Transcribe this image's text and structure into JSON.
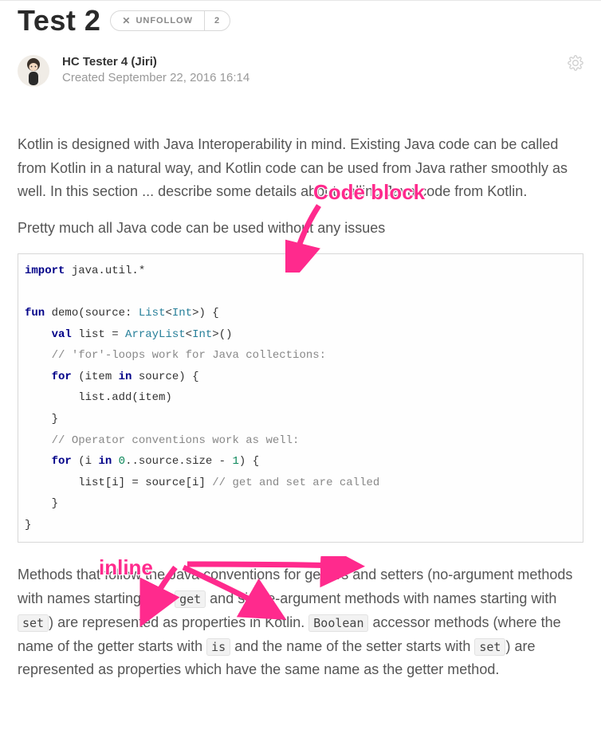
{
  "header": {
    "title": "Test 2",
    "follow": {
      "label": "UNFOLLOW",
      "count": "2"
    }
  },
  "meta": {
    "author": "HC Tester 4 (Jiri)",
    "created": "Created September 22, 2016 16:14"
  },
  "paragraphs": {
    "p1": "Kotlin is designed with Java Interoperability in mind. Existing Java code can be called from Kotlin in a natural way, and Kotlin code can be used from Java rather smoothly as well. In this section ... describe some details about calling Java code from Kotlin.",
    "p2": "Pretty much all Java code can be used without any issues",
    "p3a": "Methods that follow the Java conventions for getters and setters (no-argument methods with names starting with ",
    "p3b": " and single-argument methods with names starting with ",
    "p3c": ") are represented as properties in Kotlin. ",
    "p3d": " accessor methods (where the name of the getter starts with ",
    "p3e": " and the name of the setter starts with ",
    "p3f": ") are represented as properties which have the same name as the getter method."
  },
  "inline_codes": {
    "get": "get",
    "set1": "set",
    "bool": "Boolean",
    "is": "is",
    "set2": "set"
  },
  "code": {
    "l1_kw": "import",
    "l1_rest": " java.util.*",
    "l3_kw": "fun",
    "l3_fn": " demo",
    "l3_open": "(source: ",
    "l3_type1": "List",
    "l3_lt": "<",
    "l3_type2": "Int",
    "l3_gt": ">",
    "l3_close": ") {",
    "l4_kw": "val",
    "l4_mid": " list = ",
    "l4_type1": "ArrayList",
    "l4_lt": "<",
    "l4_type2": "Int",
    "l4_gt": ">",
    "l4_end": "()",
    "l5_cmt": "// 'for'-loops work for Java collections:",
    "l6_kw": "for",
    "l6_open": " (item ",
    "l6_kw2": "in",
    "l6_rest": " source) {",
    "l7": "list.add(item)",
    "l8": "}",
    "l9_cmt": "// Operator conventions work as well:",
    "l10_kw": "for",
    "l10_open": " (i ",
    "l10_kw2": "in",
    "l10_sp": " ",
    "l10_num": "0",
    "l10_mid": "..source.size - ",
    "l10_num2": "1",
    "l10_close": ") {",
    "l11_a": "list[i] = source[i] ",
    "l11_cmt": "// get and set are called",
    "l12": "}",
    "l13": "}"
  },
  "annotations": {
    "code_block": "Code block",
    "inline": "inline"
  }
}
